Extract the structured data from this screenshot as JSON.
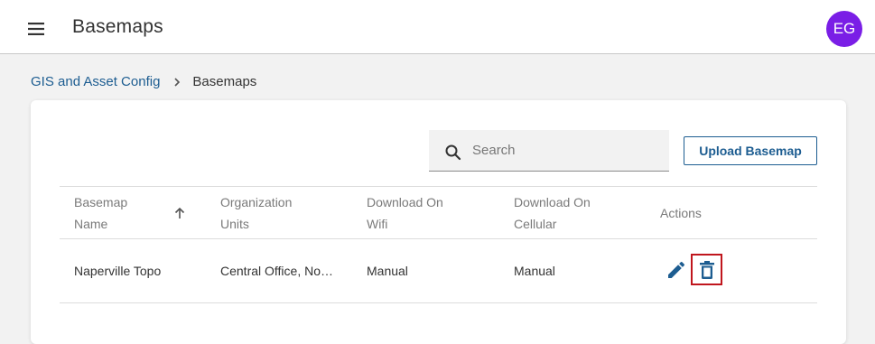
{
  "appbar": {
    "title": "Basemaps",
    "avatar_initials": "EG"
  },
  "breadcrumb": {
    "parent": "GIS and Asset Config",
    "current": "Basemaps"
  },
  "toolbar": {
    "search_placeholder": "Search",
    "upload_label": "Upload Basemap"
  },
  "table": {
    "columns": [
      {
        "label": "Basemap Name",
        "line1": "Basemap",
        "line2": "Name"
      },
      {
        "label": "Organization Units",
        "line1": "Organization",
        "line2": "Units"
      },
      {
        "label": "Download On Wifi",
        "line1": "Download On",
        "line2": "Wifi"
      },
      {
        "label": "Download On Cellular",
        "line1": "Download On",
        "line2": "Cellular"
      },
      {
        "label": "Actions",
        "line1": "Actions",
        "line2": ""
      }
    ],
    "rows": [
      {
        "name": "Naperville Topo",
        "org_units": "Central Office, No…",
        "wifi": "Manual",
        "cellular": "Manual"
      }
    ]
  },
  "colors": {
    "accent": "#1d5d91",
    "avatar": "#7a1ee6",
    "highlight": "#c0161d"
  },
  "icons": {
    "menu": "hamburger-menu-icon",
    "search": "search-icon",
    "sort": "arrow-up-icon",
    "edit": "pencil-icon",
    "delete": "trash-icon",
    "chevron": "chevron-right-icon"
  }
}
